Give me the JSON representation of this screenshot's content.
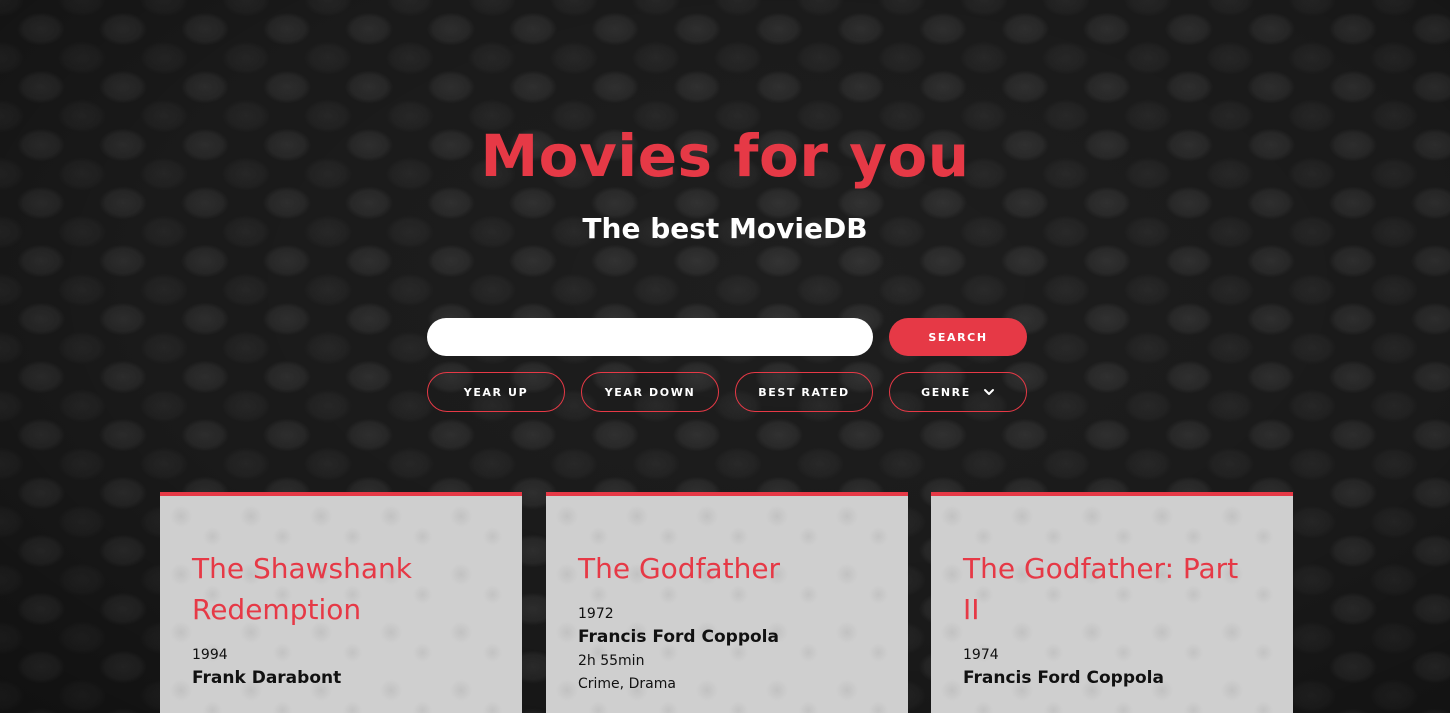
{
  "header": {
    "title": "Movies for you",
    "subtitle": "The best MovieDB"
  },
  "search": {
    "value": "",
    "placeholder": "",
    "button_label": "SEARCH"
  },
  "filters": {
    "year_up": "YEAR UP",
    "year_down": "YEAR DOWN",
    "best_rated": "BEST RATED",
    "genre": "GENRE",
    "genre_icon": "chevron-down-icon"
  },
  "colors": {
    "accent": "#e63946",
    "card_background": "#cfcfcf",
    "page_background": "#1e1e1e"
  },
  "movies": [
    {
      "title": "The Shawshank Redemption",
      "year": "1994",
      "director": "Frank Darabont"
    },
    {
      "title": "The Godfather",
      "year": "1972",
      "director": "Francis Ford Coppola",
      "duration": "2h 55min",
      "genres": "Crime, Drama"
    },
    {
      "title": "The Godfather: Part II",
      "year": "1974",
      "director": "Francis Ford Coppola"
    }
  ]
}
